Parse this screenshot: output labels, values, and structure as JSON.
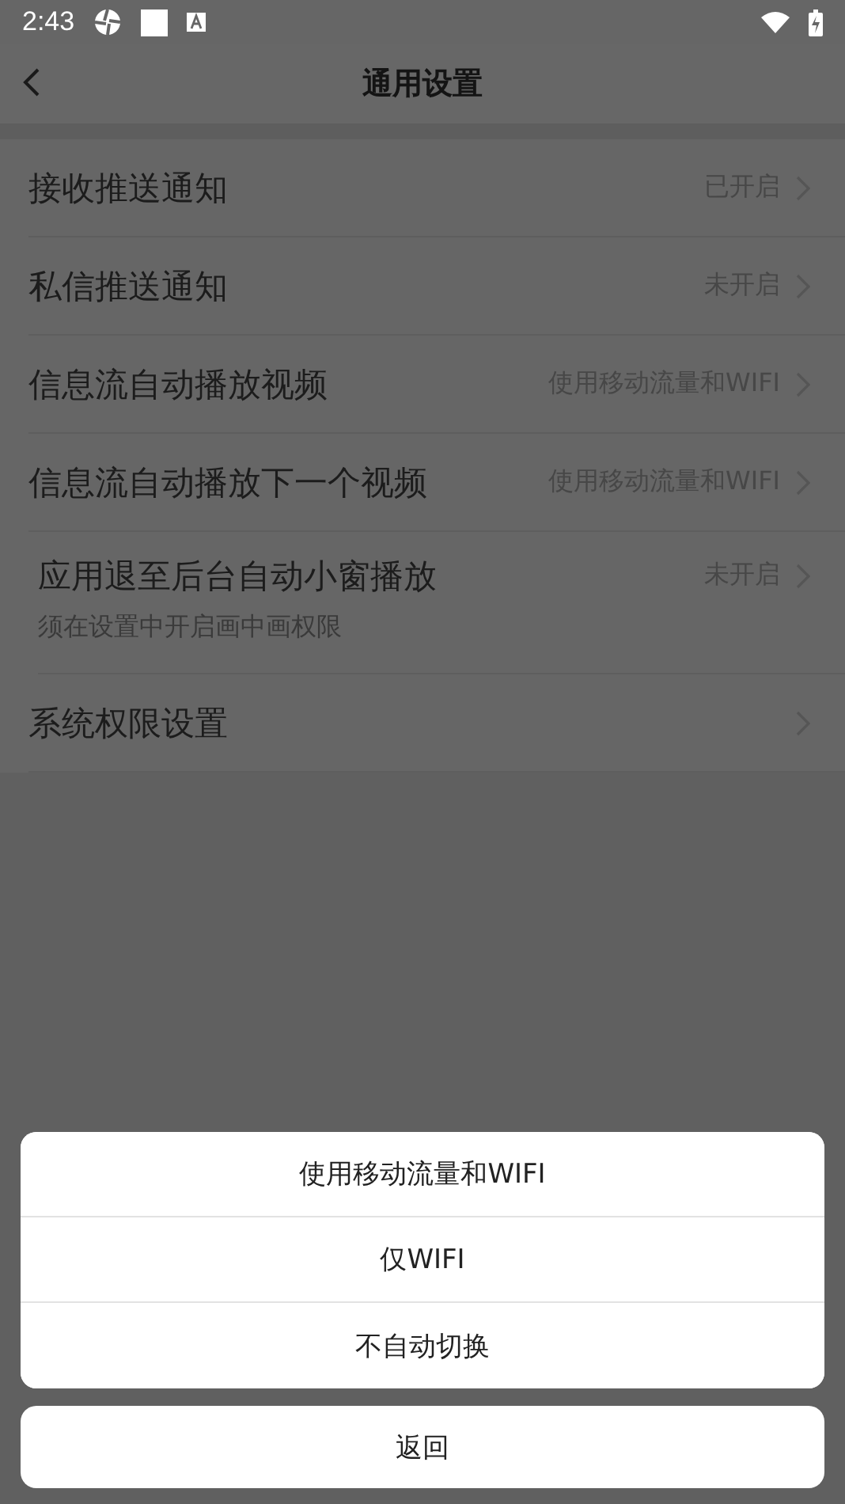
{
  "status_bar": {
    "time": "2:43"
  },
  "header": {
    "title": "通用设置"
  },
  "settings": [
    {
      "label": "接收推送通知",
      "value": "已开启"
    },
    {
      "label": "私信推送通知",
      "value": "未开启"
    },
    {
      "label": "信息流自动播放视频",
      "value": "使用移动流量和WIFI"
    },
    {
      "label": "信息流自动播放下一个视频",
      "value": "使用移动流量和WIFI"
    },
    {
      "label": "应用退至后台自动小窗播放",
      "value": "未开启",
      "note": "须在设置中开启画中画权限"
    },
    {
      "label": "系统权限设置"
    }
  ],
  "action_sheet": {
    "options": [
      "使用移动流量和WIFI",
      "仅WIFI",
      "不自动切换"
    ],
    "cancel": "返回"
  }
}
